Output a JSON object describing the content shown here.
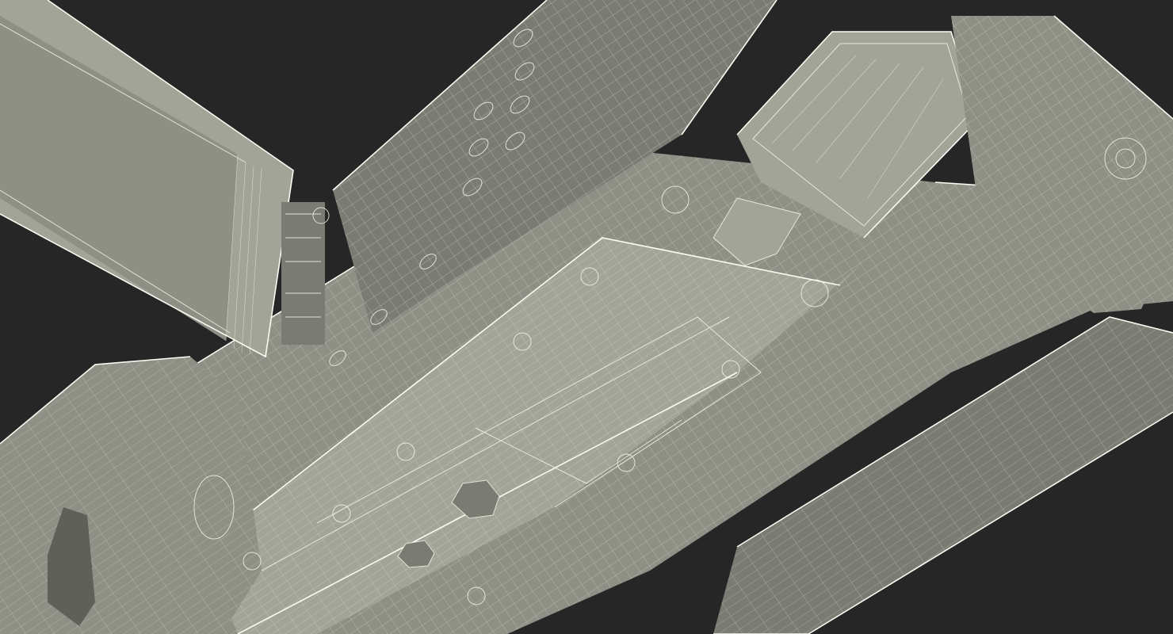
{
  "scene": {
    "subject": "camcorder-wireframe-render",
    "background_color": "#262626",
    "mesh_color": "#8e8f85",
    "wire_color": "#f2f2e6"
  }
}
